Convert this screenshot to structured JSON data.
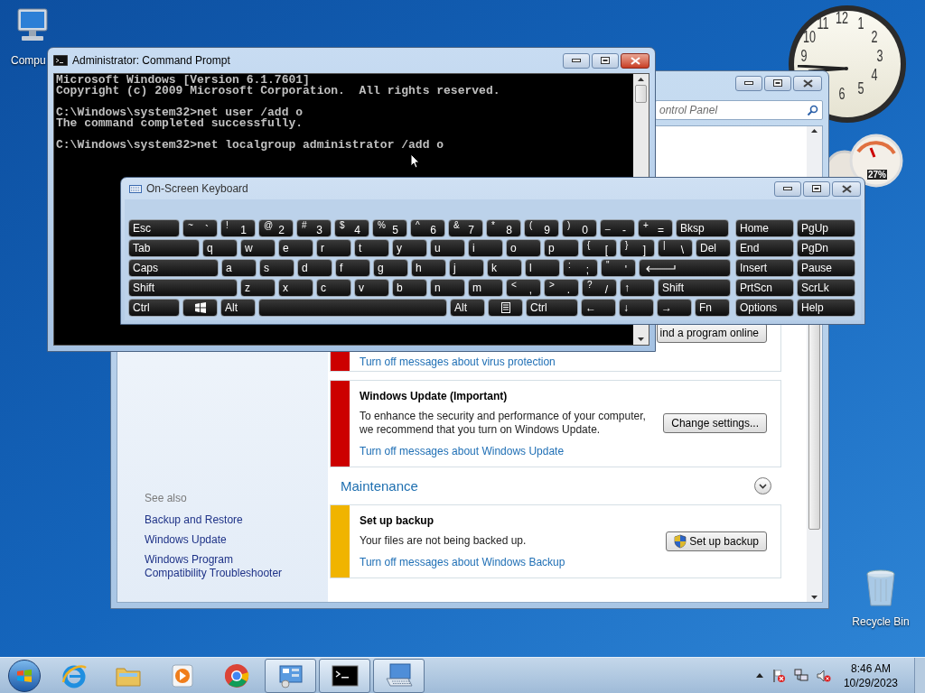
{
  "desktop": {
    "icons": [
      {
        "label": "Compu"
      },
      {
        "label": "Recycle Bin"
      }
    ]
  },
  "gadgets": {
    "clock": {
      "numerals": [
        "12",
        "1",
        "2",
        "3",
        "4",
        "5",
        "6",
        "9",
        "10",
        "11"
      ]
    },
    "cpu_meter": {
      "reading": "27%"
    }
  },
  "control_panel": {
    "search": {
      "placeholder": "ontrol Panel"
    },
    "see_also": {
      "heading": "See also",
      "links": [
        "Backup and Restore",
        "Windows Update",
        "Windows Program Compatibility Troubleshooter"
      ]
    },
    "sections": [
      {
        "messages": [
          {
            "color": "#cc0000",
            "button": {
              "label": "ind a program online",
              "elevated": false
            },
            "link": "Turn off messages about virus protection"
          },
          {
            "color": "#cc0000",
            "title": "Windows Update (Important)",
            "text": "To enhance the security and performance of your computer, we recommend that you turn on Windows Update.",
            "button": {
              "label": "Change settings...",
              "elevated": false
            },
            "link": "Turn off messages about Windows Update"
          }
        ]
      },
      {
        "heading": "Maintenance",
        "expanded": false,
        "messages": [
          {
            "color": "#f0b400",
            "title": "Set up backup",
            "text": "Your files are not being backed up.",
            "button": {
              "label": "Set up backup",
              "elevated": true
            },
            "link": "Turn off messages about Windows Backup"
          }
        ]
      }
    ]
  },
  "command_prompt": {
    "title": "Administrator: Command Prompt",
    "blocks": [
      [
        "Microsoft Windows [Version 6.1.7601]",
        "Copyright (c) 2009 Microsoft Corporation.  All rights reserved."
      ],
      [
        "C:\\Windows\\system32>net user /add o",
        "The command completed successfully."
      ],
      [
        "C:\\Windows\\system32>net localgroup administrator /add o"
      ]
    ]
  },
  "on_screen_keyboard": {
    "title": "On-Screen Keyboard",
    "rows": [
      [
        {
          "kind": "text",
          "label": "Esc"
        },
        {
          "kind": "dual",
          "top": "~",
          "label": "`"
        },
        {
          "kind": "dual",
          "top": "!",
          "label": "1"
        },
        {
          "kind": "dual",
          "top": "@",
          "label": "2"
        },
        {
          "kind": "dual",
          "top": "#",
          "label": "3"
        },
        {
          "kind": "dual",
          "top": "$",
          "label": "4"
        },
        {
          "kind": "dual",
          "top": "%",
          "label": "5"
        },
        {
          "kind": "dual",
          "top": "^",
          "label": "6"
        },
        {
          "kind": "dual",
          "top": "&",
          "label": "7"
        },
        {
          "kind": "dual",
          "top": "*",
          "label": "8"
        },
        {
          "kind": "dual",
          "top": "(",
          "label": "9"
        },
        {
          "kind": "dual",
          "top": ")",
          "label": "0"
        },
        {
          "kind": "dual",
          "top": "_",
          "label": "-"
        },
        {
          "kind": "dual",
          "top": "+",
          "label": "="
        },
        {
          "kind": "text",
          "label": "Bksp"
        }
      ],
      [
        {
          "kind": "text",
          "label": "Tab"
        },
        {
          "kind": "text",
          "label": "q"
        },
        {
          "kind": "text",
          "label": "w"
        },
        {
          "kind": "text",
          "label": "e"
        },
        {
          "kind": "text",
          "label": "r"
        },
        {
          "kind": "text",
          "label": "t"
        },
        {
          "kind": "text",
          "label": "y"
        },
        {
          "kind": "text",
          "label": "u"
        },
        {
          "kind": "text",
          "label": "i"
        },
        {
          "kind": "text",
          "label": "o"
        },
        {
          "kind": "text",
          "label": "p"
        },
        {
          "kind": "dual",
          "top": "{",
          "label": "["
        },
        {
          "kind": "dual",
          "top": "}",
          "label": "]"
        },
        {
          "kind": "dual",
          "top": "|",
          "label": "\\"
        },
        {
          "kind": "text",
          "label": "Del"
        }
      ],
      [
        {
          "kind": "text",
          "label": "Caps"
        },
        {
          "kind": "text",
          "label": "a"
        },
        {
          "kind": "text",
          "label": "s"
        },
        {
          "kind": "text",
          "label": "d"
        },
        {
          "kind": "text",
          "label": "f"
        },
        {
          "kind": "text",
          "label": "g"
        },
        {
          "kind": "text",
          "label": "h"
        },
        {
          "kind": "text",
          "label": "j"
        },
        {
          "kind": "text",
          "label": "k"
        },
        {
          "kind": "text",
          "label": "l"
        },
        {
          "kind": "dual",
          "top": ":",
          "label": ";"
        },
        {
          "kind": "dual",
          "top": "\"",
          "label": "'"
        },
        {
          "kind": "enter"
        }
      ],
      [
        {
          "kind": "text",
          "label": "Shift"
        },
        {
          "kind": "text",
          "label": "z"
        },
        {
          "kind": "text",
          "label": "x"
        },
        {
          "kind": "text",
          "label": "c"
        },
        {
          "kind": "text",
          "label": "v"
        },
        {
          "kind": "text",
          "label": "b"
        },
        {
          "kind": "text",
          "label": "n"
        },
        {
          "kind": "text",
          "label": "m"
        },
        {
          "kind": "dual",
          "top": "<",
          "label": ","
        },
        {
          "kind": "dual",
          "top": ">",
          "label": "."
        },
        {
          "kind": "dual",
          "top": "?",
          "label": "/"
        },
        {
          "kind": "text",
          "label": "↑"
        },
        {
          "kind": "text",
          "label": "Shift"
        }
      ],
      [
        {
          "kind": "text",
          "label": "Ctrl"
        },
        {
          "kind": "windows"
        },
        {
          "kind": "text",
          "label": "Alt"
        },
        {
          "kind": "space"
        },
        {
          "kind": "text",
          "label": "Alt"
        },
        {
          "kind": "menu"
        },
        {
          "kind": "text",
          "label": "Ctrl"
        },
        {
          "kind": "text",
          "label": "←"
        },
        {
          "kind": "text",
          "label": "↓"
        },
        {
          "kind": "text",
          "label": "→"
        },
        {
          "kind": "text",
          "label": "Fn"
        }
      ]
    ],
    "side_keys": [
      [
        "Home",
        "PgUp"
      ],
      [
        "End",
        "PgDn"
      ],
      [
        "Insert",
        "Pause"
      ],
      [
        "PrtScn",
        "ScrLk"
      ],
      [
        "Options",
        "Help"
      ]
    ]
  },
  "taskbar": {
    "apps": [
      {
        "running": false
      },
      {
        "running": false
      },
      {
        "running": false
      },
      {
        "running": false
      },
      {
        "running": true
      },
      {
        "running": true
      },
      {
        "running": true
      }
    ],
    "tray": {
      "time": "8:46 AM",
      "date": "10/29/2023"
    }
  }
}
